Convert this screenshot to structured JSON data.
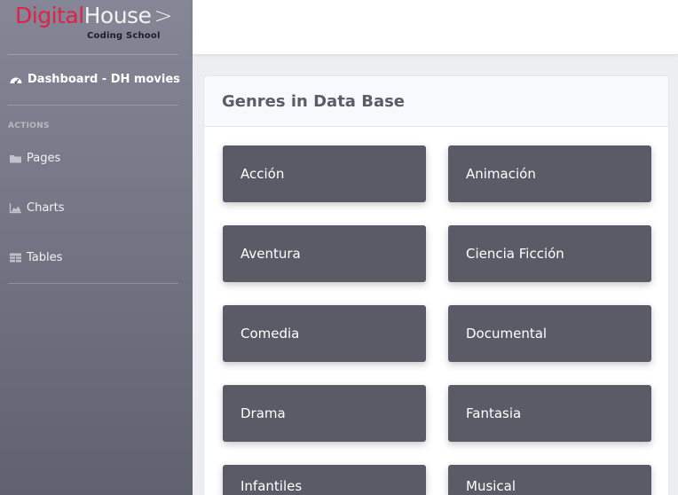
{
  "brand": {
    "name_part1": "Digital",
    "name_part2": "House",
    "chevron": ">",
    "subtitle": "Coding School"
  },
  "sidebar": {
    "dashboard_label": "Dashboard - DH movies",
    "actions_heading": "ACTIONS",
    "items": [
      {
        "label": "Pages",
        "icon": "folder-icon"
      },
      {
        "label": "Charts",
        "icon": "area-chart-icon"
      },
      {
        "label": "Tables",
        "icon": "table-icon"
      }
    ]
  },
  "card": {
    "title": "Genres in Data Base"
  },
  "genres": [
    "Acción",
    "Animación",
    "Aventura",
    "Ciencia Ficción",
    "Comedia",
    "Documental",
    "Drama",
    "Fantasia",
    "Infantiles",
    "Musical"
  ],
  "colors": {
    "brand_red": "#e0214a",
    "sidebar_top": "#858796",
    "sidebar_bottom": "#60616f",
    "genre_tile": "#5b5b68"
  }
}
